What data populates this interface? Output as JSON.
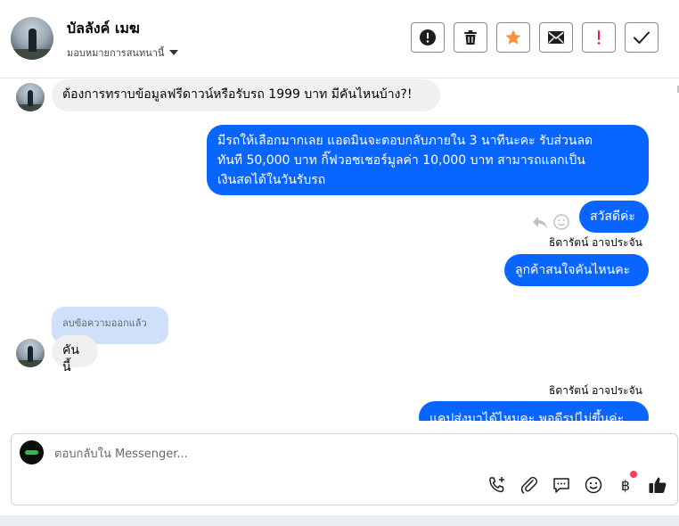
{
  "header": {
    "contact_name": "บัลลังค์ เมฆ",
    "assign_label": "มอบหมายการสนทนานี้",
    "actions": [
      {
        "name": "report-button",
        "icon": "alert-circle-icon"
      },
      {
        "name": "delete-button",
        "icon": "trash-icon"
      },
      {
        "name": "star-button",
        "icon": "star-icon"
      },
      {
        "name": "mark-unread-button",
        "icon": "envelope-icon"
      },
      {
        "name": "mark-important-button",
        "icon": "exclamation-icon"
      },
      {
        "name": "mark-done-button",
        "icon": "check-icon"
      }
    ]
  },
  "messages": {
    "m1": "ต้องการทราบข้อมูลฟรีดาวน์หรือรับรถ 1999 บาท มีคันไหนบ้าง?!",
    "m2_line1": "มีรถให้เลือกมากเลย แอดมินจะตอบกลับภายใน 3 นาทีนะคะ รับส่วนลด",
    "m2_line2": "ทันที 50,000 บาท กิ๊ฟวอชเชอร์มูลค่า 10,000 บาท สามารถแลกเป็น",
    "m2_line3": "เงินสดได้ในวันรับรถ",
    "m3": "สวัสดีค่ะ",
    "sender1": "ธิดารัตน์ อาจประจัน",
    "m4": "ลูกค้าสนใจคันไหนคะ",
    "deleted": "ลบข้อความออกแล้ว",
    "m5": "คันนี้",
    "sender2": "ธิดารัตน์ อาจประจัน",
    "m6": "แคปส่งมาได้ไหมคะ พอดีรูปไม่ขึ้นค่ะ"
  },
  "composer": {
    "placeholder": "ตอบกลับใน Messenger..."
  },
  "colors": {
    "outgoing_bubble": "#0866ff",
    "incoming_bubble": "#f0f0f0",
    "deleted_bubble": "#cfe0fb",
    "star": "#f7923a",
    "important": "#e41e3f",
    "notification_dot": "#fa3e5e"
  }
}
